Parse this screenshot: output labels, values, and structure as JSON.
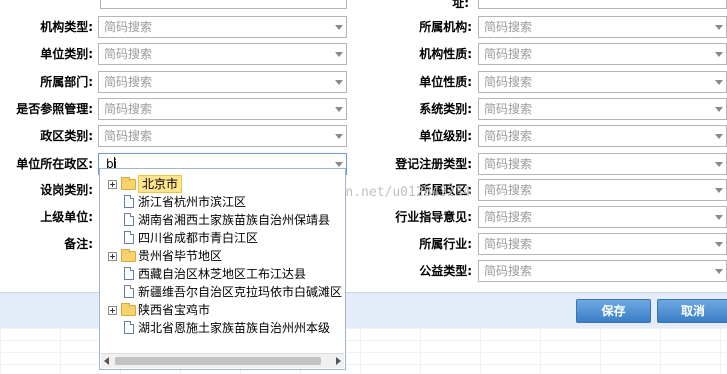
{
  "top_cut_label": "址:",
  "search_placeholder": "简码搜索",
  "left_fields": [
    {
      "label": "机构类型:"
    },
    {
      "label": "单位类别:"
    },
    {
      "label": "所属部门:"
    },
    {
      "label": "是否参照管理:"
    },
    {
      "label": "政区类别:"
    },
    {
      "label": "单位所在政区:",
      "value": "bj"
    },
    {
      "label": "设岗类别:"
    },
    {
      "label": "上级单位:"
    },
    {
      "label": "备注:"
    }
  ],
  "right_fields": [
    {
      "label": "所属机构:"
    },
    {
      "label": "机构性质:"
    },
    {
      "label": "单位性质:"
    },
    {
      "label": "系统类别:"
    },
    {
      "label": "单位级别:"
    },
    {
      "label": "登记注册类型:"
    },
    {
      "label": "所属政区:"
    },
    {
      "label": "行业指导意见:"
    },
    {
      "label": "所属行业:"
    },
    {
      "label": "公益类型:"
    }
  ],
  "tree_items": [
    {
      "text": "北京市",
      "type": "folder",
      "selected": true
    },
    {
      "text": "浙江省杭州市滨江区",
      "type": "file"
    },
    {
      "text": "湖南省湘西土家族苗族自治州保靖县",
      "type": "file"
    },
    {
      "text": "四川省成都市青白江区",
      "type": "file"
    },
    {
      "text": "贵州省毕节地区",
      "type": "folder"
    },
    {
      "text": "西藏自治区林芝地区工布江达县",
      "type": "file"
    },
    {
      "text": "新疆维吾尔自治区克拉玛依市白碱滩区",
      "type": "file"
    },
    {
      "text": "陕西省宝鸡市",
      "type": "folder"
    },
    {
      "text": "湖北省恩施土家族苗族自治州州本级",
      "type": "file"
    }
  ],
  "watermark": "http://blog.csdn.net/u012843234",
  "buttons": {
    "save": "保存",
    "cancel": "取消"
  }
}
